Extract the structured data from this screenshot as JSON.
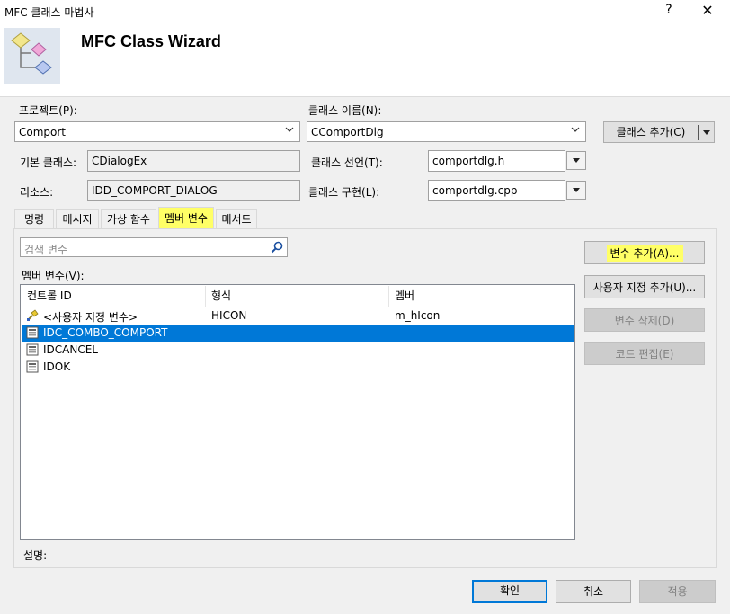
{
  "window": {
    "title": "MFC 클래스 마법사",
    "help_label": "?",
    "close_label": "✕"
  },
  "header": {
    "title": "MFC Class Wizard"
  },
  "project": {
    "label": "프로젝트(P):",
    "value": "Comport"
  },
  "class_name": {
    "label": "클래스 이름(N):",
    "value": "CComportDlg"
  },
  "add_class": {
    "label": "클래스 추가(C)"
  },
  "base_class": {
    "label": "기본 클래스:",
    "value": "CDialogEx"
  },
  "class_decl": {
    "label": "클래스 선언(T):",
    "value": "comportdlg.h"
  },
  "resource": {
    "label": "리소스:",
    "value": "IDD_COMPORT_DIALOG"
  },
  "class_impl": {
    "label": "클래스 구현(L):",
    "value": "comportdlg.cpp"
  },
  "tabs": [
    {
      "label": "명령"
    },
    {
      "label": "메시지"
    },
    {
      "label": "가상 함수"
    },
    {
      "label": "멤버 변수"
    },
    {
      "label": "메서드"
    }
  ],
  "search": {
    "placeholder": "검색 변수"
  },
  "member_vars": {
    "label": "멤버 변수(V):",
    "columns": [
      "컨트롤 ID",
      "형식",
      "멤버"
    ],
    "rows": [
      {
        "id": "<사용자 지정 변수>",
        "type": "HICON",
        "member": "m_hIcon",
        "icon": "custom-variable-icon"
      },
      {
        "id": "IDC_COMBO_COMPORT",
        "type": "",
        "member": "",
        "icon": "control-id-icon"
      },
      {
        "id": "IDCANCEL",
        "type": "",
        "member": "",
        "icon": "control-id-icon"
      },
      {
        "id": "IDOK",
        "type": "",
        "member": "",
        "icon": "control-id-icon"
      }
    ]
  },
  "side_buttons": {
    "add_variable": "변수 추가(A)...",
    "add_custom": "사용자 지정 추가(U)...",
    "delete_variable": "변수 삭제(D)",
    "edit_code": "코드 편집(E)"
  },
  "description": {
    "label": "설명:"
  },
  "footer": {
    "ok": "확인",
    "cancel": "취소",
    "apply": "적용"
  },
  "colors": {
    "accent": "#0078d7",
    "highlight": "#ffff66"
  }
}
